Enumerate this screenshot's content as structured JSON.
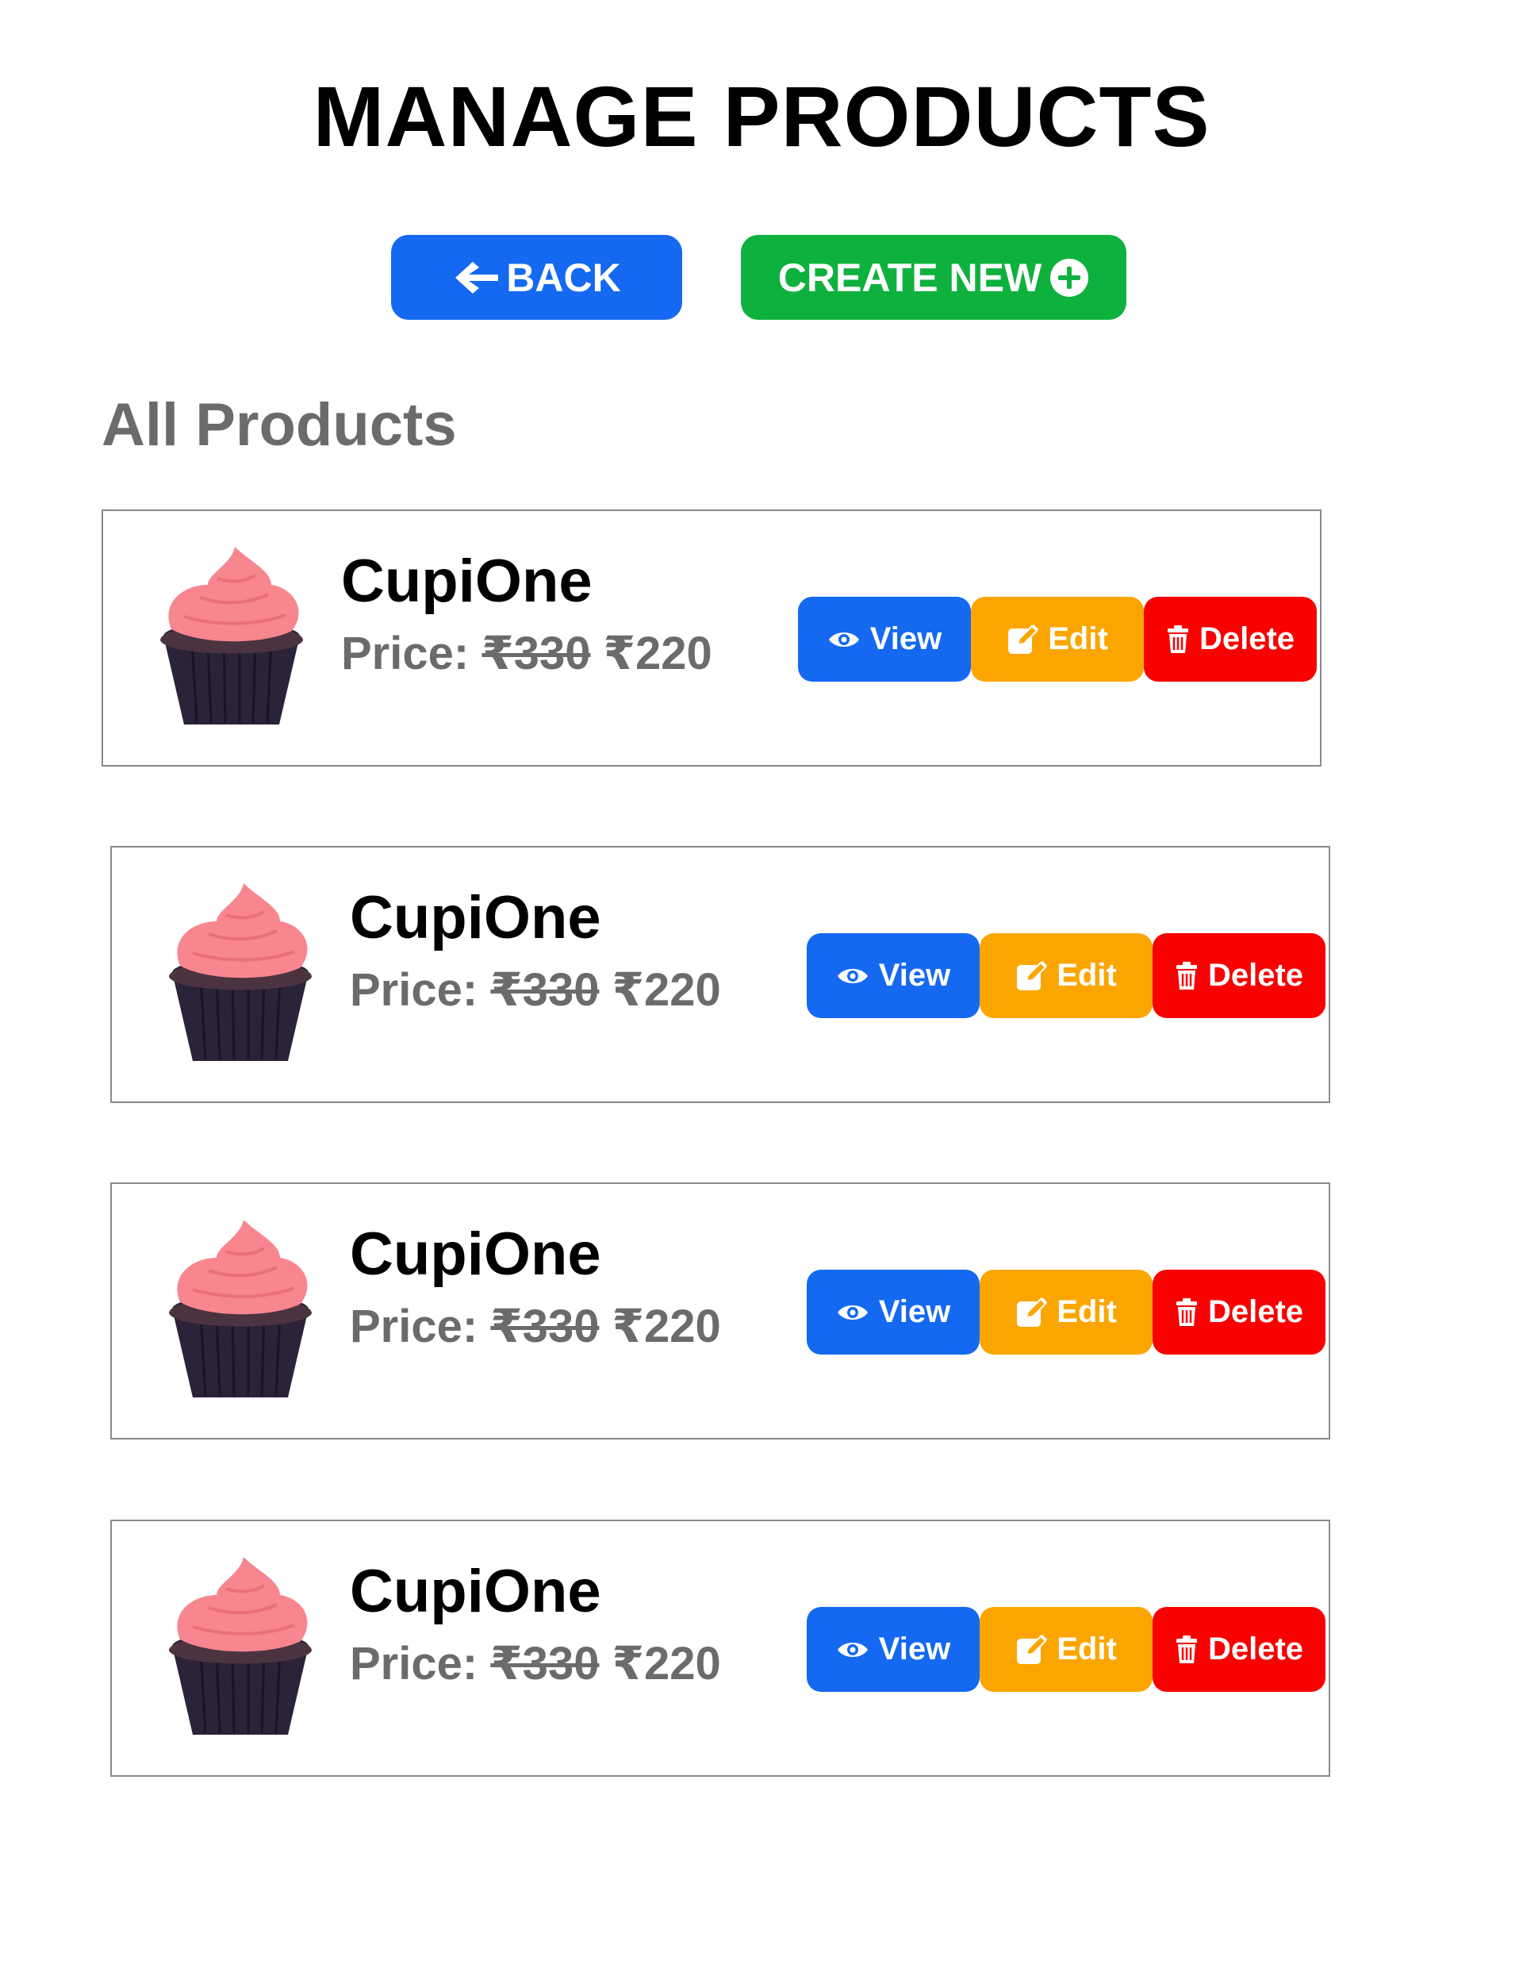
{
  "header": {
    "title": "MANAGE PRODUCTS",
    "back_label": "BACK",
    "create_label": "CREATE NEW"
  },
  "section": {
    "title": "All Products"
  },
  "products": [
    {
      "name": "CupiOne",
      "price_label": "Price:",
      "old_price": "₹330",
      "new_price": "₹220"
    },
    {
      "name": "CupiOne",
      "price_label": "Price:",
      "old_price": "₹330",
      "new_price": "₹220"
    },
    {
      "name": "CupiOne",
      "price_label": "Price:",
      "old_price": "₹330",
      "new_price": "₹220"
    },
    {
      "name": "CupiOne",
      "price_label": "Price:",
      "old_price": "₹330",
      "new_price": "₹220"
    }
  ],
  "actions": {
    "view_label": "View",
    "edit_label": "Edit",
    "delete_label": "Delete"
  },
  "icons": {
    "back": "arrow-left-icon",
    "create": "plus-circle-icon",
    "view": "eye-icon",
    "edit": "edit-icon",
    "delete": "trash-icon",
    "product_image": "cupcake-image"
  },
  "colors": {
    "primary_blue": "#1469f0",
    "create_green": "#0fb13e",
    "edit_orange": "#fba600",
    "delete_red": "#f70101",
    "muted_text": "#6b6b6b"
  }
}
